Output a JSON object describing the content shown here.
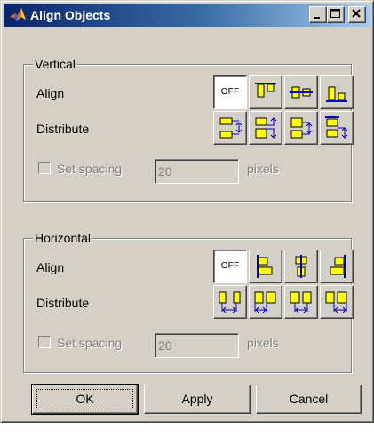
{
  "window": {
    "title": "Align Objects",
    "icon": "matlab-logo-icon"
  },
  "caption_buttons": {
    "minimize": "minimize-icon",
    "maximize": "maximize-icon",
    "close": "close-icon"
  },
  "vertical": {
    "title": "Vertical",
    "align_label": "Align",
    "distribute_label": "Distribute",
    "off_label": "OFF",
    "align_buttons": [
      "align-off",
      "align-top-icon",
      "align-middle-icon",
      "align-bottom-icon"
    ],
    "distribute_buttons": [
      "distribute-vertical-1-icon",
      "distribute-vertical-2-icon",
      "distribute-vertical-3-icon",
      "distribute-vertical-4-icon"
    ],
    "set_spacing_label": "Set spacing",
    "spacing_value": "20",
    "units_label": "pixels"
  },
  "horizontal": {
    "title": "Horizontal",
    "align_label": "Align",
    "distribute_label": "Distribute",
    "off_label": "OFF",
    "align_buttons": [
      "align-off",
      "align-left-icon",
      "align-center-icon",
      "align-right-icon"
    ],
    "distribute_buttons": [
      "distribute-horizontal-1-icon",
      "distribute-horizontal-2-icon",
      "distribute-horizontal-3-icon",
      "distribute-horizontal-4-icon"
    ],
    "set_spacing_label": "Set spacing",
    "spacing_value": "20",
    "units_label": "pixels"
  },
  "buttons": {
    "ok": "OK",
    "apply": "Apply",
    "cancel": "Cancel"
  },
  "colors": {
    "titlebar_start": "#0a246a",
    "titlebar_end": "#a6caf0",
    "icon_fill": "#ffff00",
    "icon_line": "#0000cc",
    "dialog_bg": "#d4d0c8"
  }
}
